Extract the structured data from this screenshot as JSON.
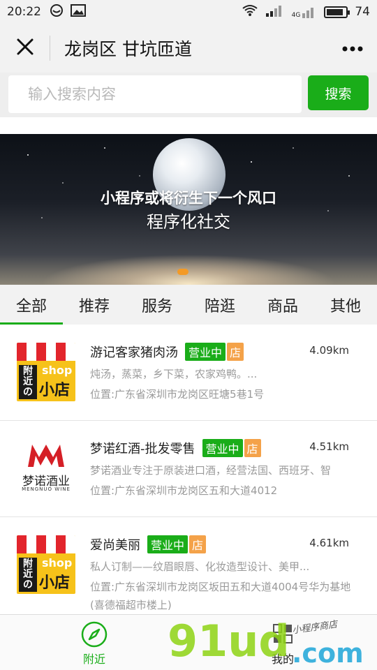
{
  "status_bar": {
    "time": "20:22",
    "battery": "74",
    "network": "4G"
  },
  "header": {
    "title": "龙岗区 甘坑匝道"
  },
  "search": {
    "placeholder": "输入搜索内容",
    "button_label": "搜索"
  },
  "banner": {
    "headline": "小程序或将衍生下一个风口",
    "subline": "程序化社交"
  },
  "tabs": [
    {
      "label": "全部",
      "active": true
    },
    {
      "label": "推荐"
    },
    {
      "label": "服务"
    },
    {
      "label": "陪逛"
    },
    {
      "label": "商品"
    },
    {
      "label": "其他"
    }
  ],
  "stores": [
    {
      "name": "游记客家猪肉汤",
      "status": "营业中",
      "type": "店",
      "distance": "4.09km",
      "desc": "炖汤，蒸菜，乡下菜，农家鸡鸭。...",
      "address": "位置:广东省深圳市龙岗区旺塘5巷1号",
      "logo": {
        "line1": "附近の",
        "line2": "shop",
        "line3": "小店"
      }
    },
    {
      "name": "梦诺红酒-批发零售",
      "status": "营业中",
      "type": "店",
      "distance": "4.51km",
      "desc": "梦诺酒业专注于原装进口酒，经营法国、西班牙、智",
      "address": "位置:广东省深圳市龙岗区五和大道4012",
      "logo": {
        "cn": "梦诺酒业",
        "en": "MENGNUO WINE"
      }
    },
    {
      "name": "爱尚美丽",
      "status": "营业中",
      "type": "店",
      "distance": "4.61km",
      "desc": "私人订制——纹眉眼唇、化妆造型设计、美甲...",
      "address": "位置:广东省深圳市龙岗区坂田五和大道4004号华为基地(喜德福超市楼上)",
      "logo": {
        "line1": "附近の",
        "line2": "shop",
        "line3": "小店"
      }
    }
  ],
  "bottom_nav": {
    "nearby": "附近",
    "mine": "我的"
  },
  "watermark": {
    "main": "91ud",
    "suffix": ".com",
    "tagline": "小程序商店"
  },
  "colors": {
    "accent": "#1aad19",
    "shop_badge": "#f4a249",
    "banner_dot": "#f39a26"
  }
}
